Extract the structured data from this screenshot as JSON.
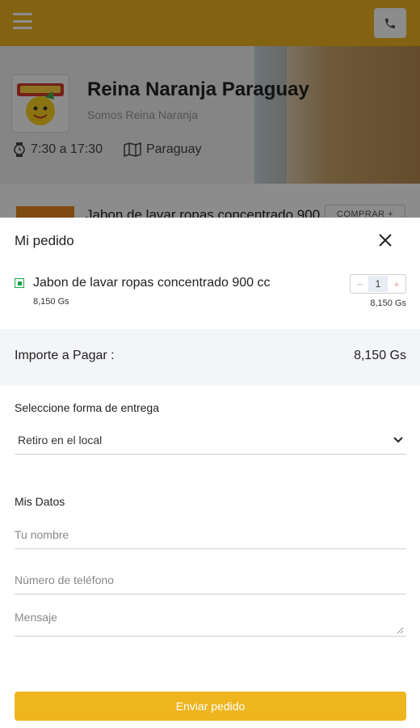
{
  "background": {
    "store": {
      "name": "Reina Naranja Paraguay",
      "tagline": "Somos Reina Naranja",
      "hours": "7:30 a 17:30",
      "location": "Paraguay"
    },
    "product_preview": {
      "name": "Jabon de lavar ropas concentrado 900 cc",
      "buy_label": "COMPRAR +"
    }
  },
  "order": {
    "title": "Mi pedido",
    "items": [
      {
        "name": "Jabon de lavar ropas concentrado 900 cc",
        "unit_price": "8,150 Gs",
        "quantity": "1",
        "subtotal": "8,150 Gs"
      }
    ],
    "total_label": "Importe a Pagar :",
    "total_value": "8,150 Gs"
  },
  "delivery": {
    "label": "Seleccione forma de entrega",
    "selected": "Retiro en el local"
  },
  "my_data": {
    "label": "Mis Datos",
    "name_placeholder": "Tu nombre",
    "phone_placeholder": "Número de teléfono",
    "message_placeholder": "Mensaje"
  },
  "submit_label": "Enviar pedido",
  "colors": {
    "brand": "#efb51f",
    "veg_indicator": "#1aa34a"
  }
}
